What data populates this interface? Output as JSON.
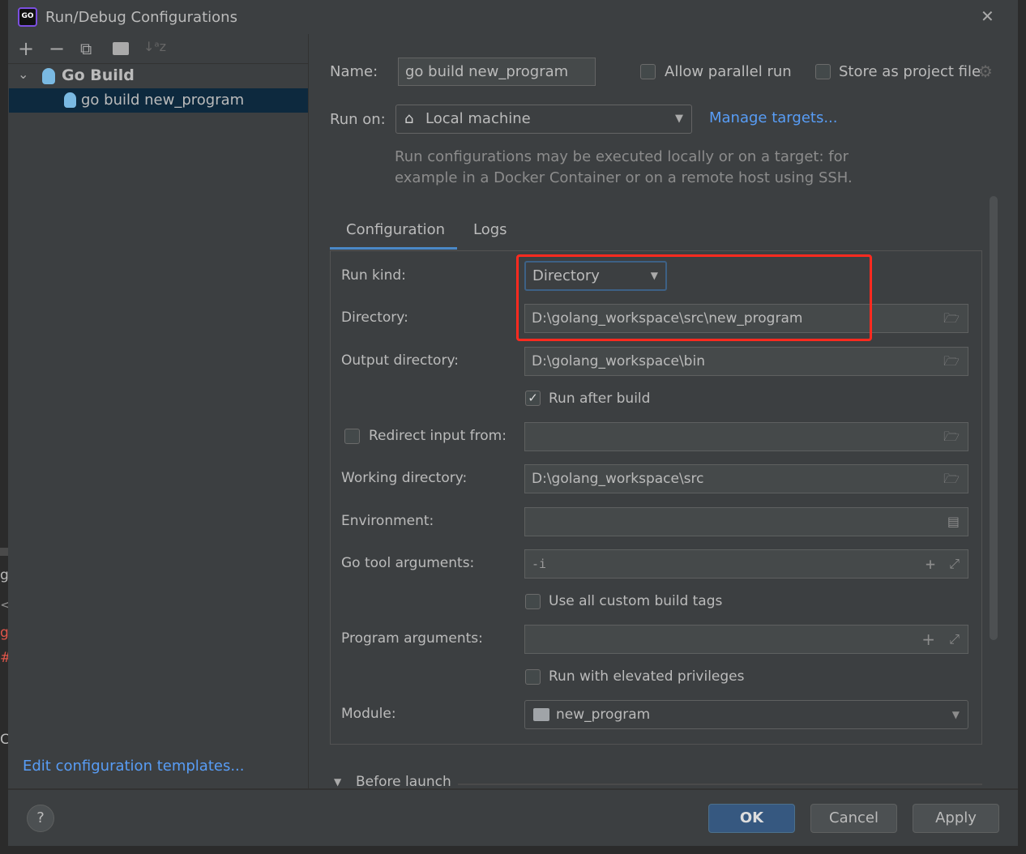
{
  "window": {
    "title": "Run/Debug Configurations",
    "close": "✕"
  },
  "editor_strip": [
    "g",
    "<",
    "g",
    "#",
    ".",
    "C"
  ],
  "toolbar": {
    "add": "+",
    "remove": "−",
    "copy": "⧉",
    "folder": "📁",
    "sort": "↓ᵃz"
  },
  "tree": {
    "group": "Go Build",
    "item": "go build new_program"
  },
  "edit_templates": "Edit configuration templates...",
  "name": {
    "label": "Name:",
    "value": "go build new_program"
  },
  "allow_parallel": {
    "label": "Allow parallel run",
    "checked": false
  },
  "store_project": {
    "label": "Store as project file",
    "checked": false
  },
  "run_on": {
    "label": "Run on:",
    "value": "Local machine",
    "manage": "Manage targets...",
    "hint1": "Run configurations may be executed locally or on a target: for",
    "hint2": "example in a Docker Container or on a remote host using SSH."
  },
  "tabs": [
    {
      "label": "Configuration",
      "active": true
    },
    {
      "label": "Logs",
      "active": false
    }
  ],
  "config": {
    "run_kind": {
      "label": "Run kind:",
      "value": "Directory"
    },
    "directory": {
      "label": "Directory:",
      "value": "D:\\golang_workspace\\src\\new_program"
    },
    "output_directory": {
      "label": "Output directory:",
      "value": "D:\\golang_workspace\\bin"
    },
    "run_after_build": {
      "label": "Run after build",
      "checked": true
    },
    "redirect_input": {
      "label": "Redirect input from:",
      "checked": false,
      "value": ""
    },
    "working_directory": {
      "label": "Working directory:",
      "value": "D:\\golang_workspace\\src"
    },
    "environment": {
      "label": "Environment:",
      "value": ""
    },
    "go_tool_args": {
      "label": "Go tool arguments:",
      "value": "-i"
    },
    "custom_tags": {
      "label": "Use all custom build tags",
      "checked": false
    },
    "program_args": {
      "label": "Program arguments:",
      "value": ""
    },
    "elevated": {
      "label": "Run with elevated privileges",
      "checked": false
    },
    "module": {
      "label": "Module:",
      "value": "new_program"
    }
  },
  "before_launch": "Before launch",
  "buttons": {
    "help": "?",
    "ok": "OK",
    "cancel": "Cancel",
    "apply": "Apply"
  },
  "colors": {
    "accent": "#589df6",
    "selection": "#0d293e",
    "highlight": "#ff2a1f",
    "ok": "#365880"
  }
}
